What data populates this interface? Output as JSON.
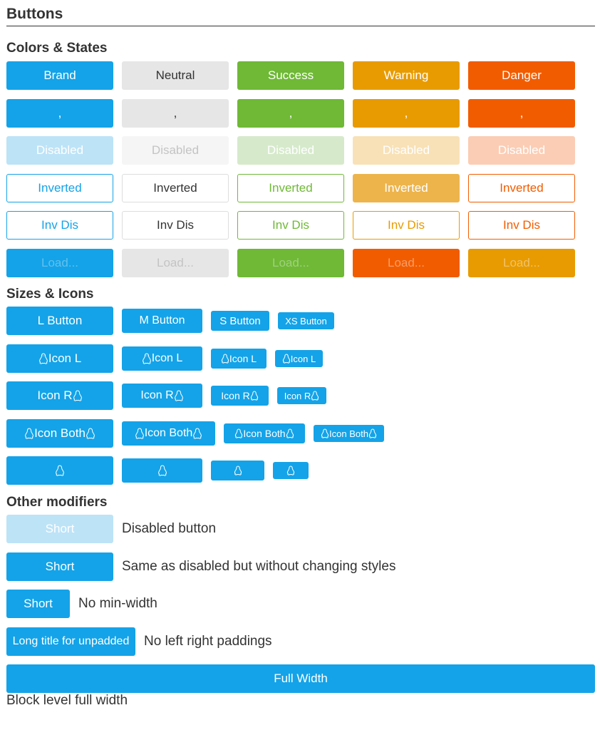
{
  "page": {
    "title": "Buttons"
  },
  "sections": {
    "colors": "Colors & States",
    "sizes": "Sizes & Icons",
    "modifiers": "Other modifiers"
  },
  "colors_rows": {
    "labels": [
      "Brand",
      "Neutral",
      "Success",
      "Warning",
      "Danger"
    ],
    "row2": ",",
    "disabled": "Disabled",
    "inverted": "Inverted",
    "inv_dis": "Inv Dis",
    "loading": "Load..."
  },
  "sizes_rows": {
    "text": [
      "L Button",
      "M Button",
      "S Button",
      "XS Button"
    ],
    "icon_left": "Icon L",
    "icon_right": "Icon R",
    "icon_both": "Icon Both"
  },
  "modifiers": {
    "short": "Short",
    "disabled_desc": "Disabled button",
    "same_desc": "Same as disabled but without changing styles",
    "nominw_desc": "No min-width",
    "long_title": "Long title for unpadded",
    "unpadded_desc": "No left right paddings",
    "full_width": "Full Width",
    "block_desc": "Block level full width"
  },
  "icons": {
    "tux": "linux-tux-icon"
  },
  "colors": {
    "brand": "#14a3e8",
    "neutral": "#e6e6e6",
    "success": "#6fb936",
    "warning": "#e89b00",
    "danger": "#f25c00"
  }
}
